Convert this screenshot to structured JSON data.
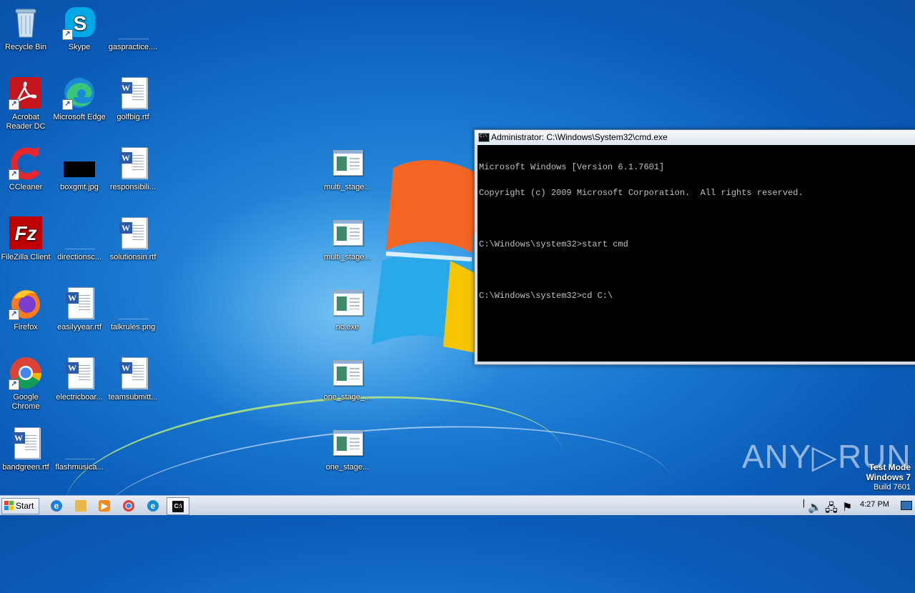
{
  "desktop": {
    "icons": [
      {
        "label": "Recycle Bin",
        "icon": "recycle-bin-icon"
      },
      {
        "label": "Skype",
        "icon": "skype-icon"
      },
      {
        "label": "gaspractice....",
        "icon": "image-file-icon"
      },
      {
        "label": "Acrobat Reader DC",
        "icon": "acrobat-reader-icon"
      },
      {
        "label": "Microsoft Edge",
        "icon": "edge-icon"
      },
      {
        "label": "golfbig.rtf",
        "icon": "word-document-icon"
      },
      {
        "label": "CCleaner",
        "icon": "ccleaner-icon"
      },
      {
        "label": "boxgmt.jpg",
        "icon": "image-file-icon"
      },
      {
        "label": "responsibili...",
        "icon": "word-document-icon"
      },
      {
        "label": "FileZilla Client",
        "icon": "filezilla-icon"
      },
      {
        "label": "directionsc...",
        "icon": "image-file-icon"
      },
      {
        "label": "solutionsin.rtf",
        "icon": "word-document-icon"
      },
      {
        "label": "Firefox",
        "icon": "firefox-icon"
      },
      {
        "label": "easilyyear.rtf",
        "icon": "word-document-icon"
      },
      {
        "label": "talkrules.png",
        "icon": "image-file-icon"
      },
      {
        "label": "Google Chrome",
        "icon": "chrome-icon"
      },
      {
        "label": "electricboar...",
        "icon": "word-document-icon"
      },
      {
        "label": "teamsubmitt...",
        "icon": "word-document-icon"
      },
      {
        "label": "bandgreen.rtf",
        "icon": "word-document-icon"
      },
      {
        "label": "flashmusica...",
        "icon": "image-file-icon"
      },
      {
        "label": "multi_stage...",
        "icon": "executable-icon"
      },
      {
        "label": "multi_stage...",
        "icon": "executable-icon"
      },
      {
        "label": "nc.exe",
        "icon": "executable-icon"
      },
      {
        "label": "one_stage_...",
        "icon": "executable-icon"
      },
      {
        "label": "one_stage...",
        "icon": "executable-icon"
      }
    ]
  },
  "cmd": {
    "title": "Administrator: C:\\Windows\\System32\\cmd.exe",
    "lines": [
      "Microsoft Windows [Version 6.1.7601]",
      "Copyright (c) 2009 Microsoft Corporation.  All rights reserved.",
      "",
      "C:\\Windows\\system32>start cmd",
      "",
      "C:\\Windows\\system32>cd C:\\"
    ]
  },
  "taskbar": {
    "start_label": "Start",
    "pinned": [
      "internet-explorer-icon",
      "file-explorer-icon",
      "media-player-icon",
      "chrome-icon",
      "edge-icon",
      "cmd-icon"
    ],
    "clock": "4:27 PM",
    "tray_icons": [
      "volume-icon",
      "network-icon",
      "action-center-flag-icon"
    ]
  },
  "watermark": {
    "brand": "ANY▷RUN",
    "test_mode": "Test Mode",
    "os": "Windows 7",
    "build": "Build 7601"
  },
  "colors": {
    "desktop_blue": "#1a78d0",
    "console_bg": "#000000",
    "console_fg": "#c0c0c0"
  }
}
